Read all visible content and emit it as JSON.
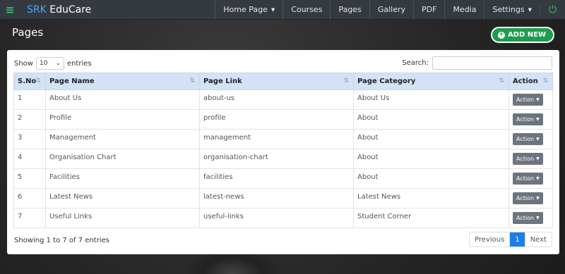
{
  "navbar": {
    "brand_prefix": "SRK",
    "brand_name": "EduCare",
    "menu": [
      {
        "label": "Home Page",
        "dropdown": true
      },
      {
        "label": "Courses",
        "dropdown": false
      },
      {
        "label": "Pages",
        "dropdown": false
      },
      {
        "label": "Gallery",
        "dropdown": false
      },
      {
        "label": "PDF",
        "dropdown": false
      },
      {
        "label": "Media",
        "dropdown": false
      },
      {
        "label": "Settings",
        "dropdown": true
      }
    ],
    "menu_icon": "hamburger-icon",
    "power_icon": "power-icon"
  },
  "page": {
    "title": "Pages",
    "add_button": "ADD NEW"
  },
  "table": {
    "show_label": "Show",
    "entries_label": "entries",
    "page_size": "10",
    "search_label": "Search:",
    "columns": [
      "S.No",
      "Page Name",
      "Page Link",
      "Page Category",
      "Action"
    ],
    "rows": [
      {
        "sno": "1",
        "name": "About Us",
        "link": "about-us",
        "category": "About Us",
        "action": "Action"
      },
      {
        "sno": "2",
        "name": "Profile",
        "link": "profile",
        "category": "About",
        "action": "Action"
      },
      {
        "sno": "3",
        "name": "Management",
        "link": "management",
        "category": "About",
        "action": "Action"
      },
      {
        "sno": "4",
        "name": "Organisation Chart",
        "link": "organisation-chart",
        "category": "About",
        "action": "Action"
      },
      {
        "sno": "5",
        "name": "Facilities",
        "link": "facilities",
        "category": "About",
        "action": "Action"
      },
      {
        "sno": "6",
        "name": "Latest News",
        "link": "latest-news",
        "category": "Latest News",
        "action": "Action"
      },
      {
        "sno": "7",
        "name": "Useful Links",
        "link": "useful-links",
        "category": "Student Corner",
        "action": "Action"
      }
    ],
    "info": "Showing 1 to 7 of 7 entries",
    "pagination": {
      "previous": "Previous",
      "current": "1",
      "next": "Next"
    }
  },
  "colors": {
    "navbar": "#343a40",
    "accent_green": "#1e9d4f",
    "header_blue": "#d2e3f7",
    "active_page": "#1c7ee8"
  }
}
